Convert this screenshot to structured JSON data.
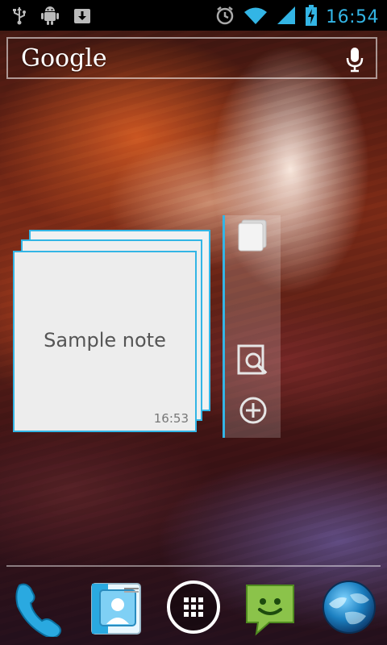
{
  "statusbar": {
    "time": "16:54",
    "left_icons": [
      "usb-icon",
      "android-debug-icon",
      "download-icon"
    ],
    "right_icons": [
      "alarm-icon",
      "wifi-icon",
      "signal-icon",
      "battery-charging-icon"
    ]
  },
  "search": {
    "logo_text": "Google",
    "voice_icon": "microphone-icon"
  },
  "notes_widget": {
    "note_title": "Sample note",
    "note_time": "16:53",
    "panel_icons": [
      "note-stack-icon",
      "search-note-icon",
      "add-note-icon"
    ]
  },
  "dock": {
    "items": [
      "phone-app-icon",
      "contacts-app-icon",
      "app-drawer-icon",
      "messaging-app-icon",
      "browser-app-icon"
    ]
  },
  "colors": {
    "accent": "#33b5e5",
    "statusbar_bg": "#000000"
  }
}
